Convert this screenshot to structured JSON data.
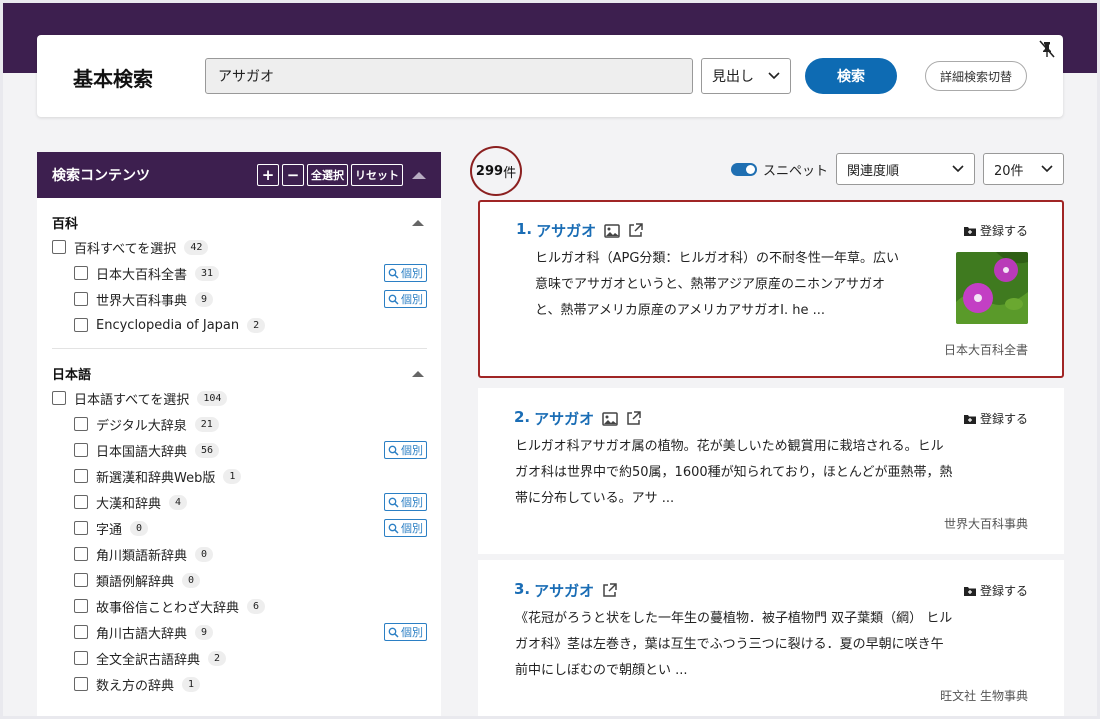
{
  "search": {
    "title": "基本検索",
    "query": "アサガオ",
    "field_select": "見出し",
    "search_label": "検索",
    "advanced_label": "詳細検索切替"
  },
  "sidebar": {
    "title": "検索コンテンツ",
    "btn_plus": "+",
    "btn_minus": "−",
    "btn_select_all": "全選択",
    "btn_reset": "リセット",
    "groups": [
      {
        "title": "百科",
        "all_label": "百科すべてを選択",
        "all_count": "42",
        "items": [
          {
            "label": "日本大百科全書",
            "count": "31",
            "indiv": "個別"
          },
          {
            "label": "世界大百科事典",
            "count": "9",
            "indiv": "個別"
          },
          {
            "label": "Encyclopedia of Japan",
            "count": "2"
          }
        ]
      },
      {
        "title": "日本語",
        "all_label": "日本語すべてを選択",
        "all_count": "104",
        "items": [
          {
            "label": "デジタル大辞泉",
            "count": "21"
          },
          {
            "label": "日本国語大辞典",
            "count": "56",
            "indiv": "個別"
          },
          {
            "label": "新選漢和辞典Web版",
            "count": "1"
          },
          {
            "label": "大漢和辞典",
            "count": "4",
            "indiv": "個別"
          },
          {
            "label": "字通",
            "count": "0",
            "indiv": "個別"
          },
          {
            "label": "角川類語新辞典",
            "count": "0"
          },
          {
            "label": "類語例解辞典",
            "count": "0"
          },
          {
            "label": "故事俗信ことわざ大辞典",
            "count": "6"
          },
          {
            "label": "角川古語大辞典",
            "count": "9",
            "indiv": "個別"
          },
          {
            "label": "全文全訳古語辞典",
            "count": "2"
          },
          {
            "label": "数え方の辞典",
            "count": "1"
          }
        ]
      }
    ]
  },
  "results_header": {
    "count_num": "299",
    "count_unit": "件",
    "snippet_label": "スニペット",
    "sort_value": "関連度順",
    "per_page_value": "20件"
  },
  "results": [
    {
      "num": "1.",
      "title": "アサガオ",
      "register": "登録する",
      "snippet": [
        "ヒルガオ科（APG分類：ヒルガオ科）の不耐冬性一年草。広い",
        "意味でアサガオというと、熱帯アジア原産のニホンアサガオ",
        "と、熱帯アメリカ原産のアメリカアサガオI. he ..."
      ],
      "source": "日本大百科全書"
    },
    {
      "num": "2.",
      "title": "アサガオ",
      "register": "登録する",
      "snippet": [
        "ヒルガオ科アサガオ属の植物。花が美しいため観賞用に栽培される。ヒル",
        "ガオ科は世界中で約50属，1600種が知られており，ほとんどが亜熱帯，熱",
        "帯に分布している。アサ ..."
      ],
      "source": "世界大百科事典"
    },
    {
      "num": "3.",
      "title": "アサガオ",
      "register": "登録する",
      "snippet": [
        "《花冠がろうと状をした一年生の蔓植物．被子植物門 双子葉類（綱） ヒル",
        "ガオ科》茎は左巻き，葉は互生でふつう三つに裂ける．夏の早朝に咲き午",
        "前中にしぼむので朝顔とい ..."
      ],
      "source": "旺文社 生物事典"
    }
  ],
  "colors": {
    "header_purple": "#3d1f4f",
    "accent_blue": "#0e6bb3",
    "highlight_red": "#a02525"
  }
}
